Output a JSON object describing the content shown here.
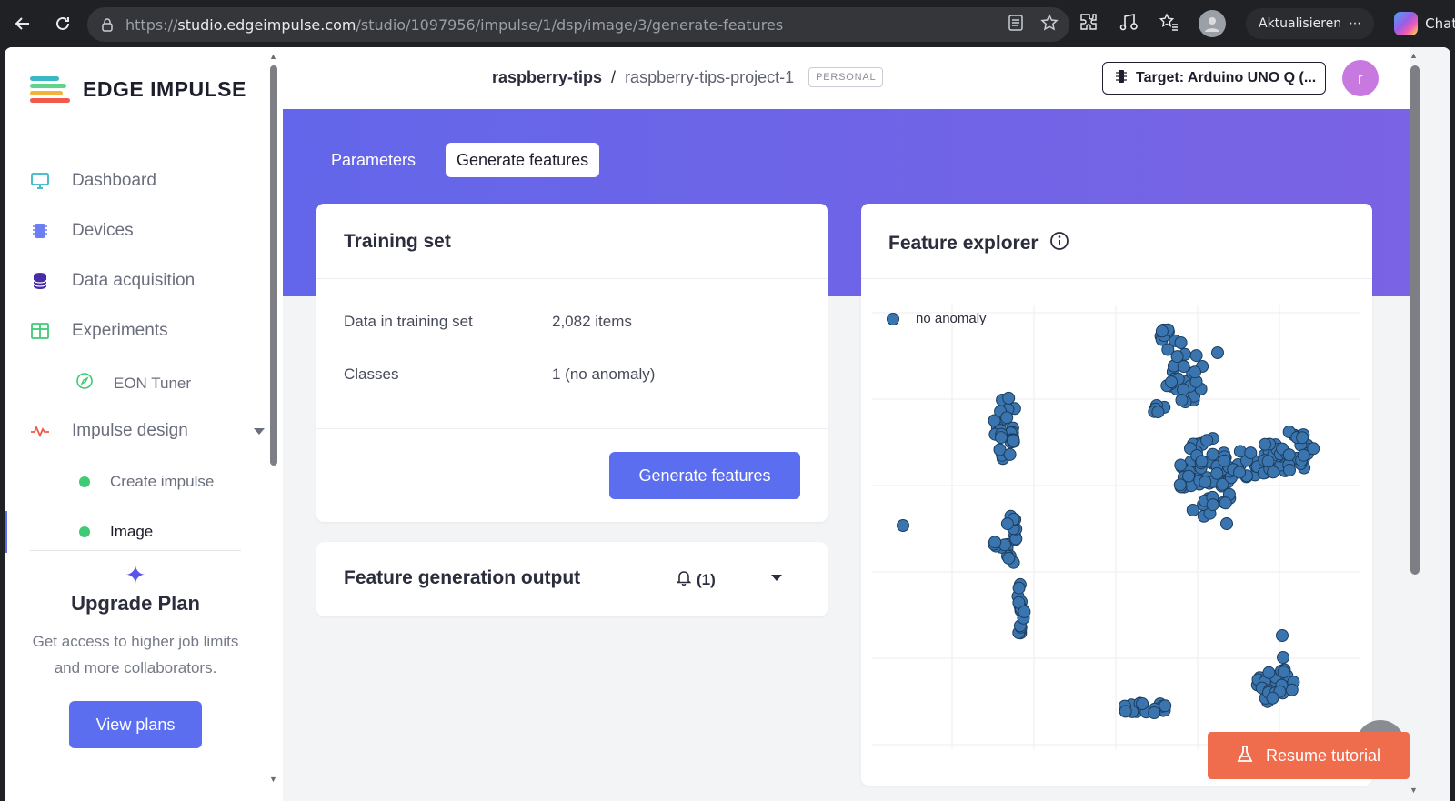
{
  "browser": {
    "url_domain": "studio.edgeimpulse.com",
    "url_prefix": "https://",
    "url_path": "/studio/1097956/impulse/1/dsp/image/3/generate-features",
    "update_label": "Aktualisieren",
    "chat_label": "Chat"
  },
  "sidebar": {
    "logo_text": "EDGE IMPULSE",
    "items": [
      {
        "label": "Dashboard",
        "icon": "monitor-icon"
      },
      {
        "label": "Devices",
        "icon": "chip-icon"
      },
      {
        "label": "Data acquisition",
        "icon": "database-icon"
      },
      {
        "label": "Experiments",
        "icon": "grid-icon"
      }
    ],
    "eon_tuner": "EON Tuner",
    "impulse_design": "Impulse design",
    "sub_items": [
      {
        "label": "Create impulse"
      },
      {
        "label": "Image"
      }
    ],
    "upgrade": {
      "title": "Upgrade Plan",
      "text": "Get access to higher job limits and more collaborators.",
      "button": "View plans"
    }
  },
  "header": {
    "owner": "raspberry-tips",
    "separator": "/",
    "project": "raspberry-tips-project-1",
    "badge": "PERSONAL",
    "target": "Target: Arduino UNO Q (...",
    "avatar_letter": "r"
  },
  "tabs": {
    "parameters": "Parameters",
    "generate": "Generate features"
  },
  "training_set": {
    "title": "Training set",
    "rows": [
      {
        "label": "Data in training set",
        "value": "2,082 items"
      },
      {
        "label": "Classes",
        "value": "1 (no anomaly)"
      }
    ],
    "button": "Generate features"
  },
  "output": {
    "title": "Feature generation output",
    "notifications": "(1)"
  },
  "feature_explorer": {
    "title": "Feature explorer",
    "legend": "no anomaly",
    "point_color": "#3a75b0"
  },
  "resume_tutorial": "Resume tutorial",
  "colors": {
    "accent": "#5b6ef0",
    "hero_start": "#6366ea",
    "hero_end": "#7a63e4",
    "resume": "#ef6c4d"
  }
}
